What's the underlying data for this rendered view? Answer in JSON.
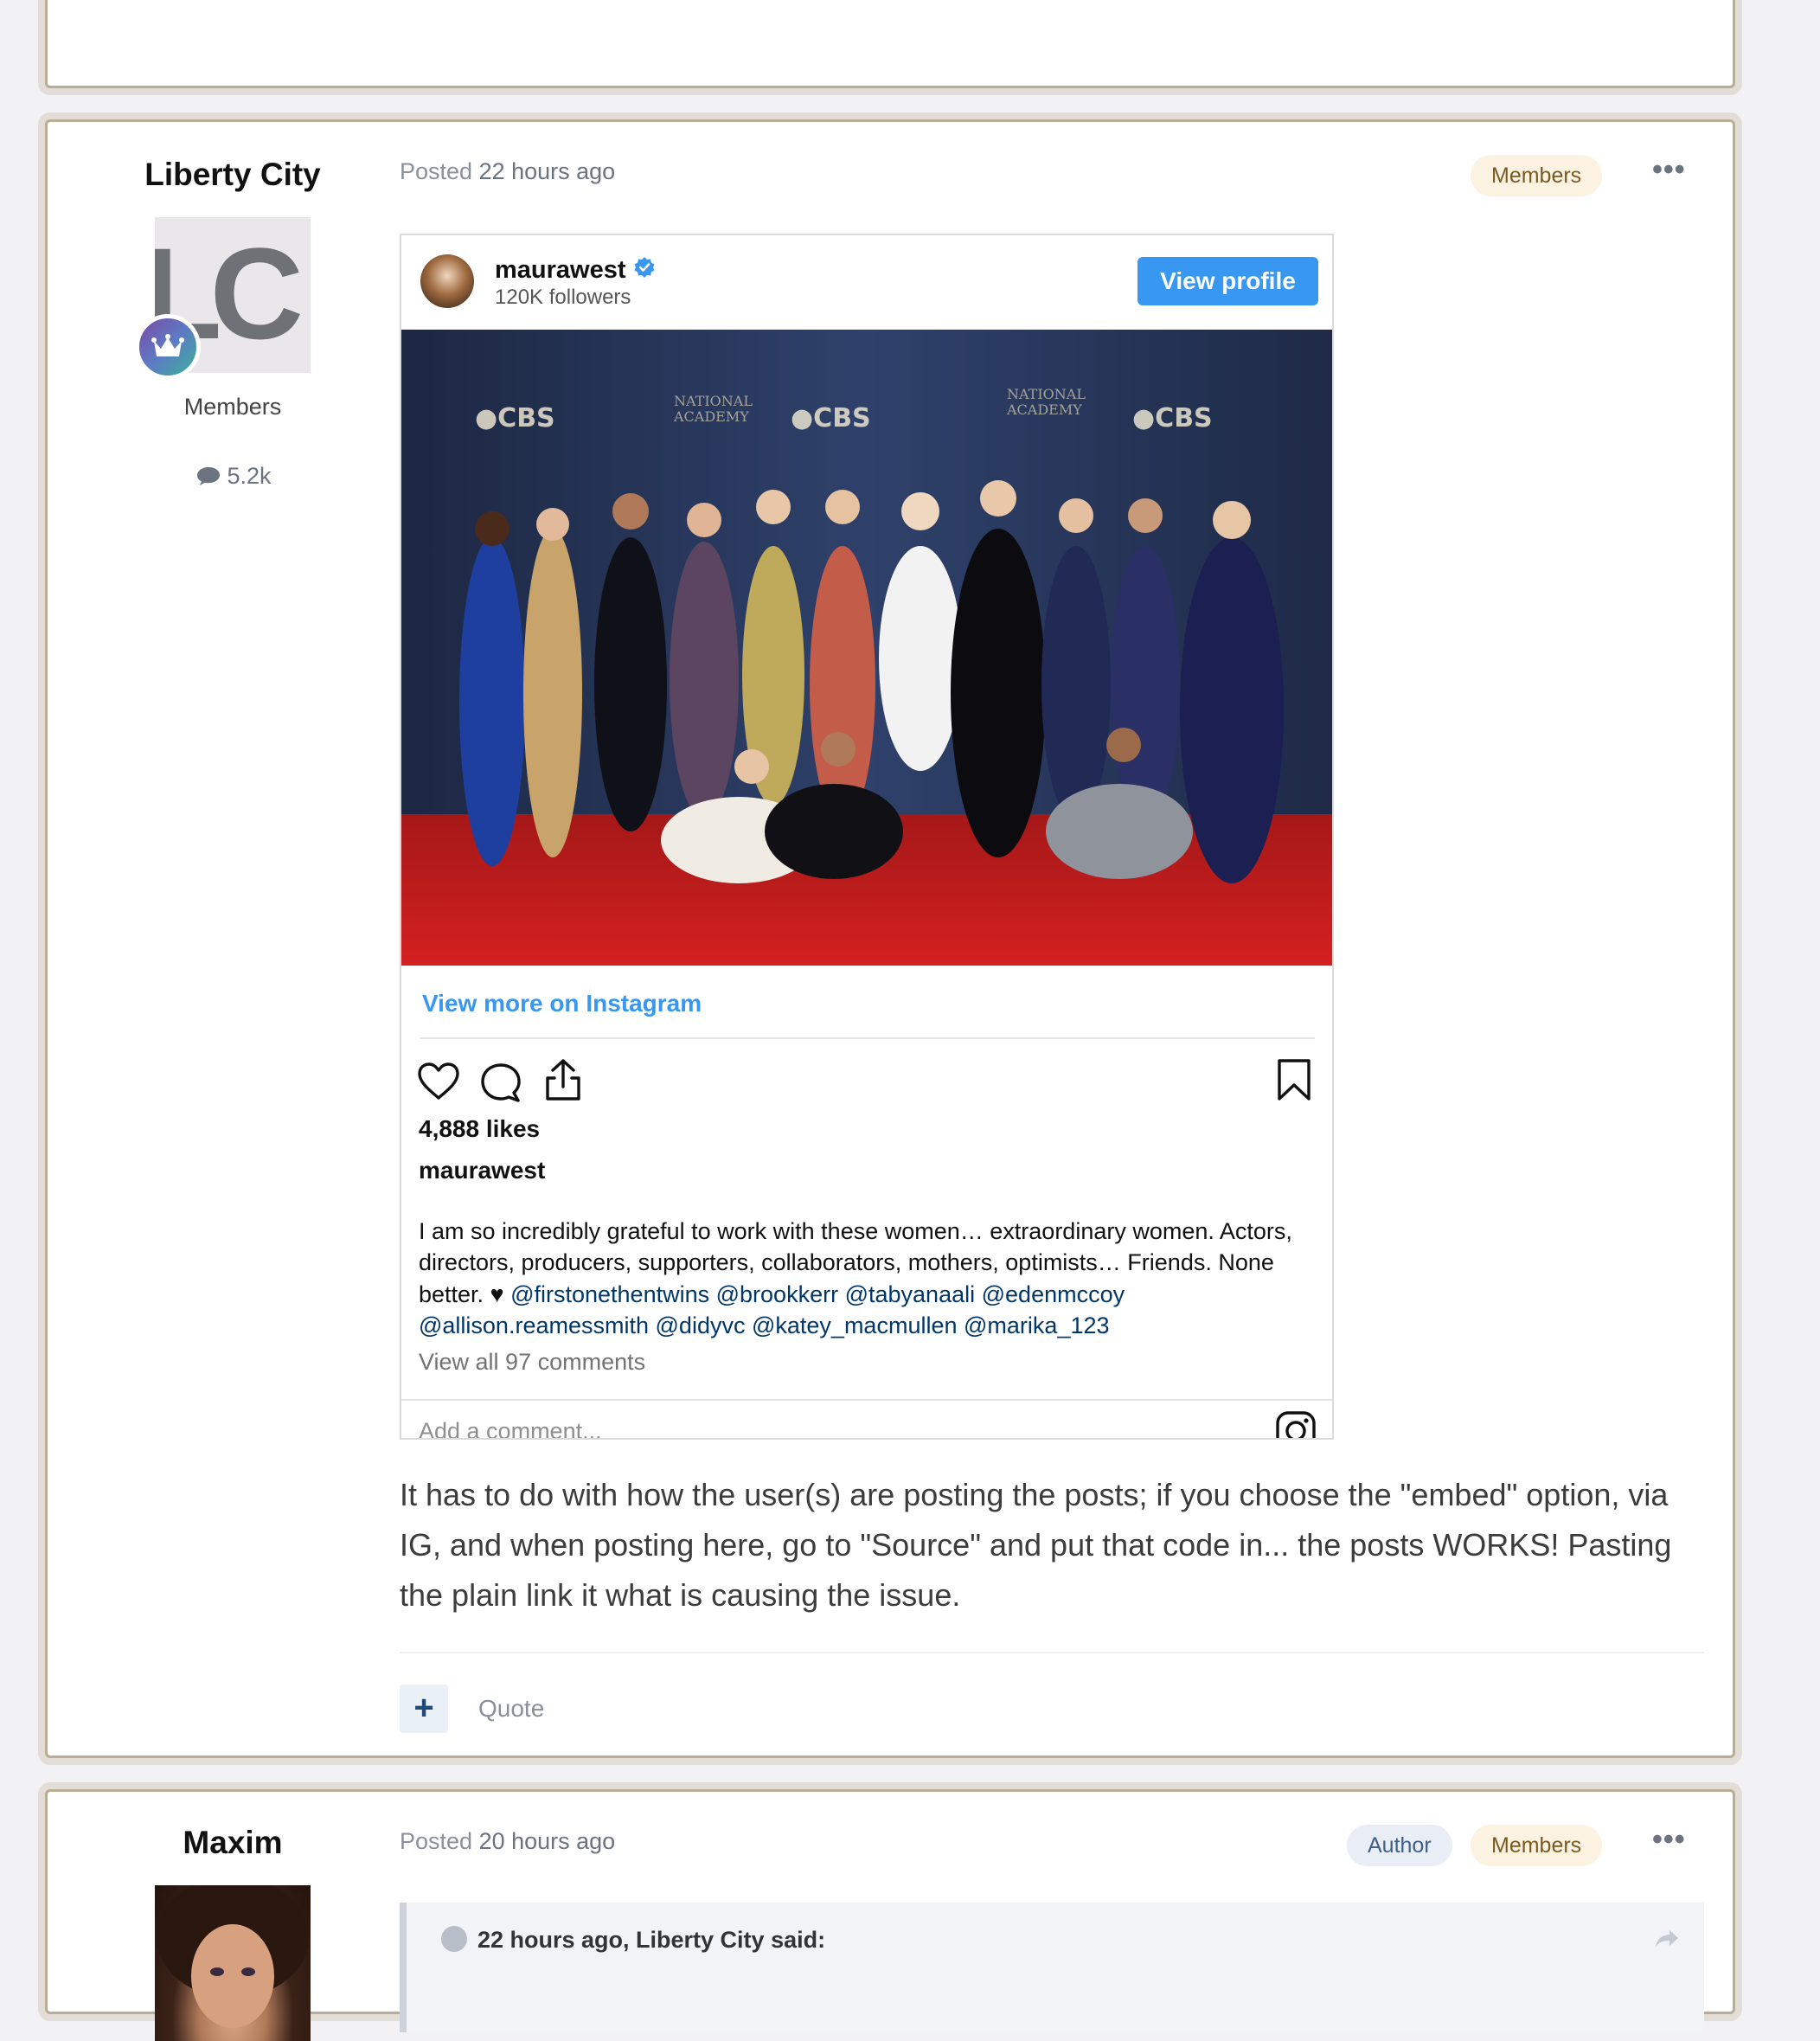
{
  "post": {
    "author": "Liberty City",
    "avatar_initials": "LC",
    "group": "Members",
    "post_count": "5.2k",
    "posted_label": "Posted",
    "posted_time": "22 hours ago",
    "badge_members": "Members",
    "more_label": "•••",
    "embed": {
      "username": "maurawest",
      "followers": "120K followers",
      "view_profile": "View profile",
      "view_more": "View more on Instagram",
      "likes": "4,888 likes",
      "caption_user": "maurawest",
      "caption_text": "I am so incredibly grateful to work with these women… extraordinary women. Actors, directors, producers, supporters, collaborators, mothers, optimists… Friends. None better. ♥ ",
      "mentions": [
        "@firstonethentwins",
        "@brookkerr",
        "@tabyanaali",
        "@edenmccoy",
        "@allison.reamessmith",
        "@didyvc",
        "@katey_macmullen",
        "@marika_123"
      ],
      "view_comments": "View all 97 comments",
      "add_comment": "Add a comment..."
    },
    "body": "It has to do with how the user(s) are posting the posts; if you choose the \"embed\" option, via IG, and when posting here, go to \"Source\" and put that code in... the posts WORKS! Pasting the plain link it what is causing the issue.",
    "rep_label": "+",
    "quote_label": "Quote"
  },
  "next_post": {
    "author": "Maxim",
    "posted_label": "Posted",
    "posted_time": "20 hours ago",
    "badge_author": "Author",
    "badge_members": "Members",
    "more_label": "•••",
    "quote_header": "22 hours ago, Liberty City said:"
  },
  "colors": {
    "card_border": "#b9ad95",
    "link_blue": "#3897f0",
    "mention": "#00376b"
  }
}
